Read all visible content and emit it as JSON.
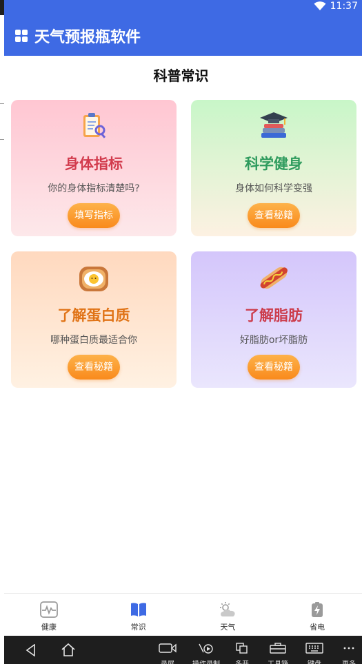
{
  "status": {
    "time": "11:37"
  },
  "app": {
    "title": "天气预报瓶软件"
  },
  "section": {
    "title": "科普常识"
  },
  "cards": [
    {
      "title": "身体指标",
      "subtitle": "你的身体指标清楚吗?",
      "button": "填写指标",
      "icon": "clipboard-icon"
    },
    {
      "title": "科学健身",
      "subtitle": "身体如何科学变强",
      "button": "查看秘籍",
      "icon": "books-graduation-cap-icon"
    },
    {
      "title": "了解蛋白质",
      "subtitle": "哪种蛋白质最适合你",
      "button": "查看秘籍",
      "icon": "egg-toast-icon"
    },
    {
      "title": "了解脂肪",
      "subtitle": "好脂肪or坏脂肪",
      "button": "查看秘籍",
      "icon": "hotdog-icon"
    }
  ],
  "tabs": [
    {
      "label": "健康",
      "icon": "health-monitor-icon",
      "active": false
    },
    {
      "label": "常识",
      "icon": "book-icon",
      "active": true
    },
    {
      "label": "天气",
      "icon": "weather-icon",
      "active": false
    },
    {
      "label": "省电",
      "icon": "battery-icon",
      "active": false
    }
  ],
  "system_nav": {
    "tools": [
      {
        "label": "录屏",
        "icon": "camera-icon"
      },
      {
        "label": "操作录制",
        "icon": "record-icon"
      },
      {
        "label": "多开",
        "icon": "multi-window-icon"
      },
      {
        "label": "工具箱",
        "icon": "toolbox-icon"
      },
      {
        "label": "键盘",
        "icon": "keyboard-icon"
      },
      {
        "label": "更多",
        "icon": "more-icon"
      }
    ]
  },
  "colors": {
    "app_bar": "#3e6ae4",
    "button": "#f98a1c",
    "tab_active": "#3e6ae4"
  }
}
